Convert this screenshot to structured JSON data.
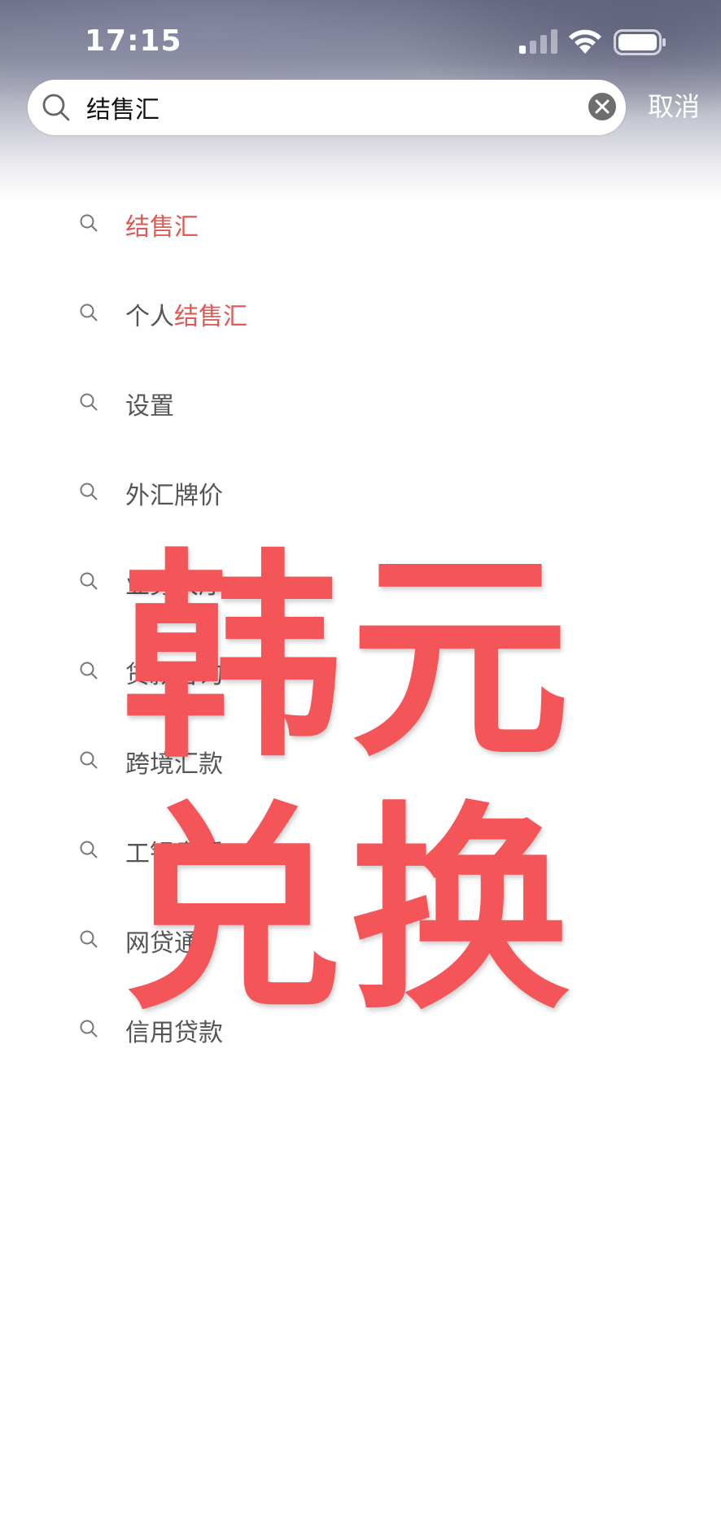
{
  "status_bar": {
    "time": "17:15"
  },
  "search": {
    "value": "结售汇",
    "cancel_label": "取消"
  },
  "suggestions": [
    {
      "prefix": "",
      "highlight": "结售汇",
      "suffix": ""
    },
    {
      "prefix": "个人",
      "highlight": "结售汇",
      "suffix": ""
    },
    {
      "prefix": "设置",
      "highlight": "",
      "suffix": ""
    },
    {
      "prefix": "外汇牌价",
      "highlight": "",
      "suffix": ""
    },
    {
      "prefix": "业务大厅",
      "highlight": "",
      "suffix": ""
    },
    {
      "prefix": "贷款咨询",
      "highlight": "",
      "suffix": ""
    },
    {
      "prefix": "跨境汇款",
      "highlight": "",
      "suffix": ""
    },
    {
      "prefix": "工银贵币",
      "highlight": "",
      "suffix": ""
    },
    {
      "prefix": "网贷通",
      "highlight": "",
      "suffix": ""
    },
    {
      "prefix": "信用贷款",
      "highlight": "",
      "suffix": ""
    }
  ],
  "overlay": {
    "line1": "韩元",
    "line2": "兑换"
  },
  "colors": {
    "highlight": "#e05a55",
    "overlay": "#f35558",
    "item_text": "#555555"
  },
  "icons": {
    "search": "search-icon",
    "clear": "clear-icon",
    "signal": "cellular-signal-icon",
    "wifi": "wifi-icon",
    "battery": "battery-icon"
  }
}
